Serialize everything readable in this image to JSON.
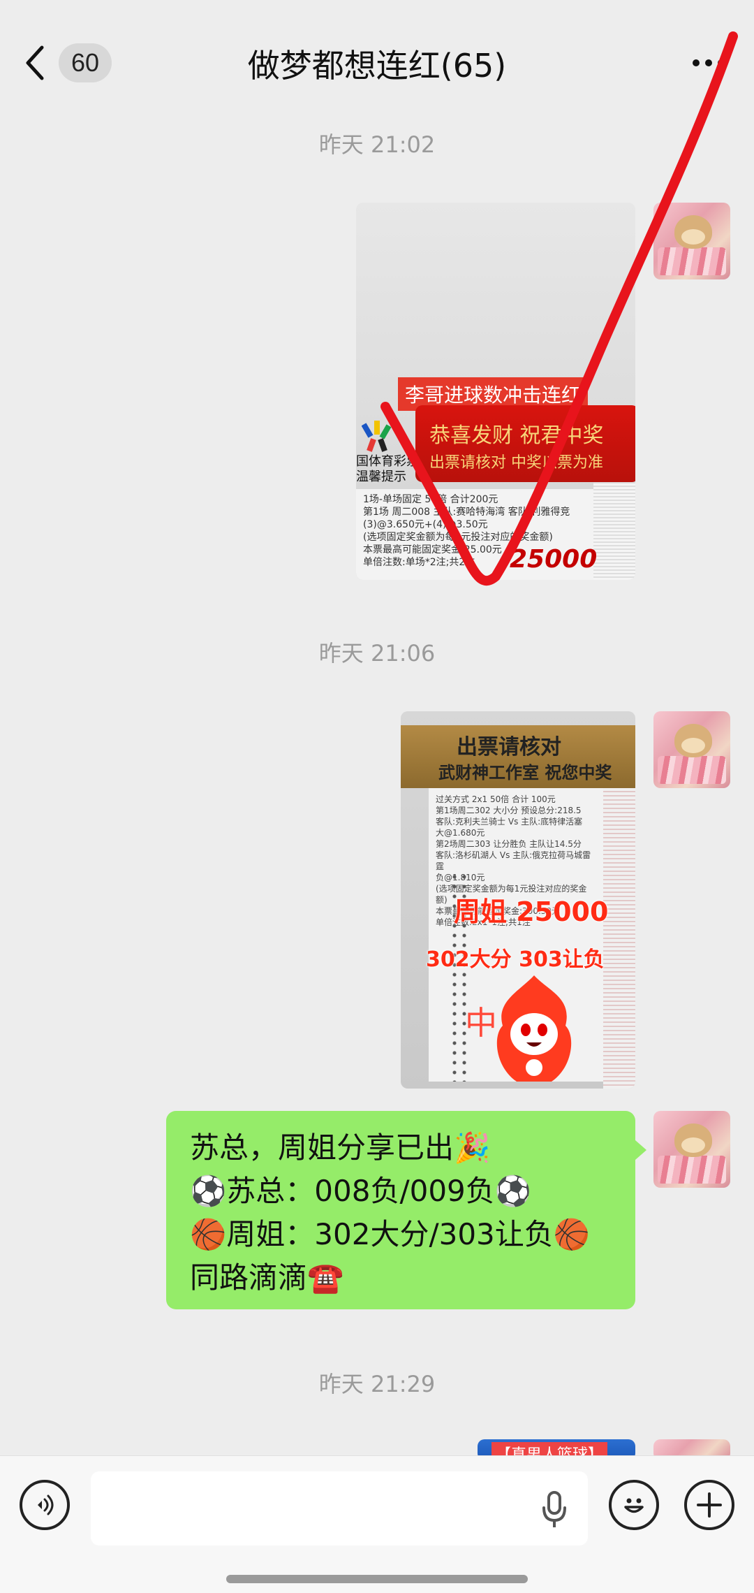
{
  "header": {
    "unread_count": "60",
    "title": "做梦都想连红(65)"
  },
  "messages": {
    "ts1": "昨天 21:02",
    "ts2": "昨天 21:06",
    "ts3": "昨天 21:29",
    "image1": {
      "banner": "李哥进球数冲击连红",
      "plate_line1": "恭喜发财 祝君中奖",
      "plate_line2": "出票请核对 中奖以票为准",
      "tag_line1": "国体育彩票",
      "tag_line2": "温馨提示",
      "ticket_lines": [
        "1场-单场固定      50倍      合计200元",
        "第1场  周二008  主队:赛哈特海湾  客队:利雅得竞",
        "(3)@3.650元+(4)@3.50元",
        "(选项固定奖金额为每1元投注对应的奖金额)",
        "本票最高可能固定奖金:25.00元",
        "单倍注数:单场*2注;共2注"
      ],
      "amount": "25000"
    },
    "image2": {
      "sign_line1": "出票请核对",
      "sign_line2": "武财神工作室 祝您中奖",
      "ticket_lines": [
        "过关方式 2x1      50倍       合计 100元",
        "第1场周二302 大小分  预设总分:218.5",
        "客队:克利夫兰骑士 Vs 主队:底特律活塞",
        "大@1.680元",
        "第2场周二303 让分胜负  主队让14.5分",
        "客队:洛杉矶湖人 Vs 主队:俄克拉荷马城雷霆",
        "负@1.810元",
        "(选项固定奖金额为每1元投注对应的奖金额)",
        "本票最高可能固定奖金:300.50元",
        "单倍注数:2x1*1注;共1注"
      ],
      "headline": "周姐 25000",
      "subline": "302大分 303让负",
      "zhong": "中"
    },
    "bubble_lines": [
      "苏总，周姐分享已出🎉",
      "⚽苏总：008负/009负⚽",
      "🏀周姐：302大分/303让负🏀",
      "同路滴滴☎️"
    ],
    "image3_caption": "【真男人篮球】"
  },
  "input": {
    "value": "",
    "placeholder": ""
  },
  "colors": {
    "background": "#ededed",
    "bubble_green": "#95ec69",
    "check_red": "#e8141c"
  },
  "icons": {
    "back": "chevron-left-icon",
    "more": "more-dots-icon",
    "voice": "voice-icon",
    "mic": "microphone-icon",
    "emoji": "emoji-icon",
    "plus": "plus-icon"
  }
}
